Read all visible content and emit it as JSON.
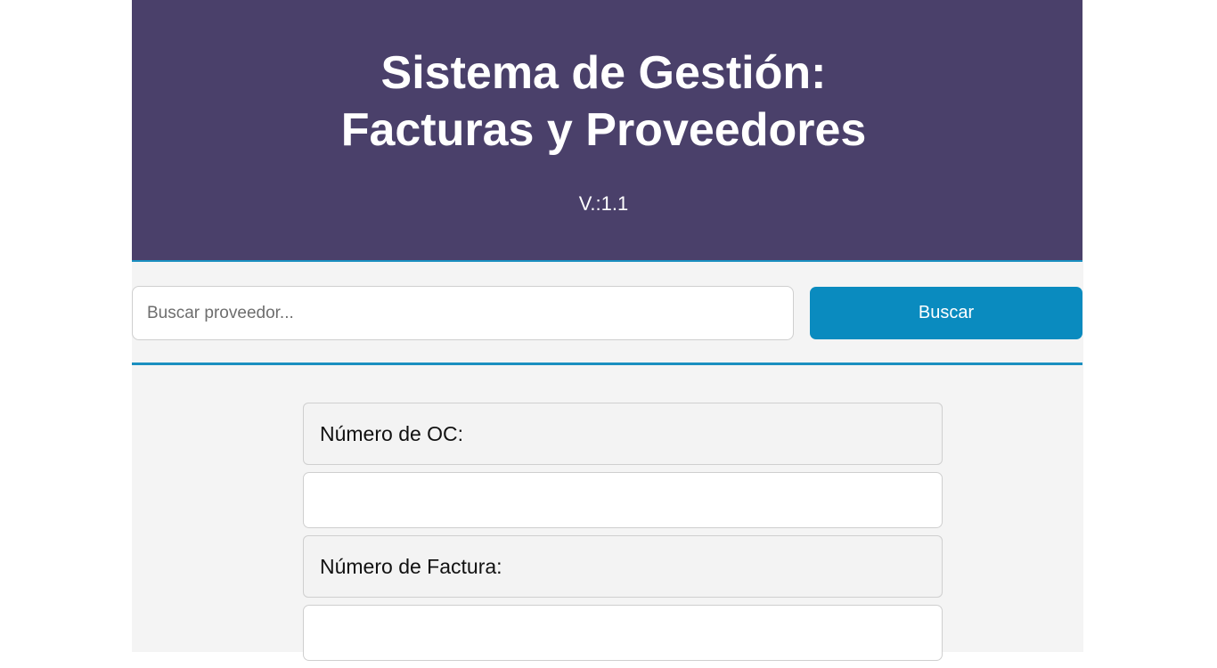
{
  "header": {
    "title_line1": "Sistema de Gestión:",
    "title_line2": "Facturas y Proveedores",
    "version": "V.:1.1",
    "background_color": "#4a406a"
  },
  "search": {
    "placeholder": "Buscar proveedor...",
    "value": "",
    "button_label": "Buscar",
    "accent_color": "#0a8bbf"
  },
  "form": {
    "fields": [
      {
        "label": "Número de OC:",
        "value": ""
      },
      {
        "label": "Número de Factura:",
        "value": ""
      }
    ]
  }
}
